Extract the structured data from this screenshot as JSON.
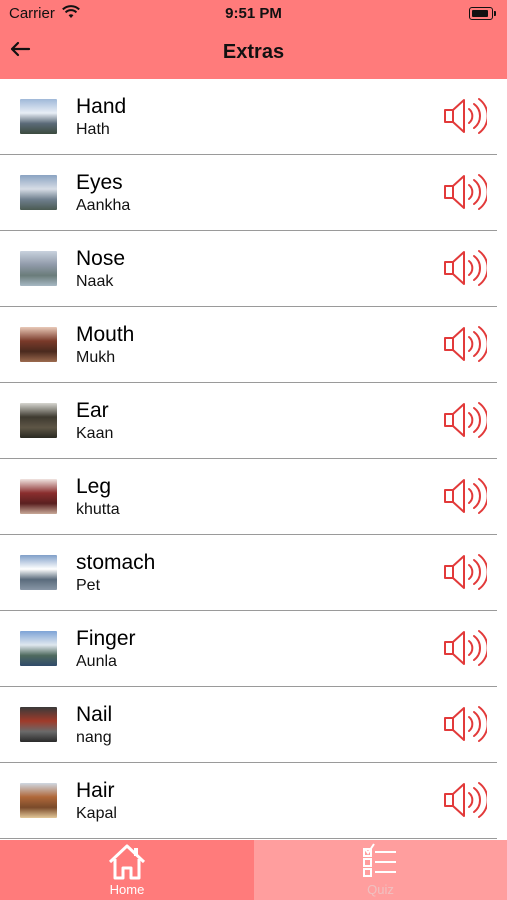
{
  "status": {
    "carrier": "Carrier",
    "time": "9:51 PM",
    "wifi_icon": "wifi-icon",
    "battery_icon": "battery-icon"
  },
  "nav": {
    "title": "Extras",
    "back_icon": "back-arrow-icon"
  },
  "items": [
    {
      "word": "Hand",
      "translation": "Hath",
      "thumb": "mountain-thumbnail",
      "colors": [
        "#9fb8d8",
        "#e8eef6",
        "#5b6a78",
        "#3b4a3e"
      ]
    },
    {
      "word": "Eyes",
      "translation": "Aankha",
      "thumb": "lake-thumbnail",
      "colors": [
        "#8aa3c2",
        "#d7dde6",
        "#6f7f8e",
        "#4a5a52"
      ]
    },
    {
      "word": "Nose",
      "translation": "Naak",
      "thumb": "lake-thumbnail",
      "colors": [
        "#c9d2de",
        "#8f99a8",
        "#6a7c7a",
        "#a7b8c4"
      ]
    },
    {
      "word": "Mouth",
      "translation": "Mukh",
      "thumb": "pagoda-thumbnail",
      "colors": [
        "#e9c9b8",
        "#7a3a2a",
        "#4a2a1e",
        "#9c6a4e"
      ]
    },
    {
      "word": "Ear",
      "translation": "Kaan",
      "thumb": "temple-thumbnail",
      "colors": [
        "#d6d6d0",
        "#3e3a30",
        "#5e5646",
        "#2a2a22"
      ]
    },
    {
      "word": "Leg",
      "translation": "khutta",
      "thumb": "pagoda-thumbnail",
      "colors": [
        "#f0e4e0",
        "#8a2e2e",
        "#5a2020",
        "#c8a898"
      ]
    },
    {
      "word": "stomach",
      "translation": "Pet",
      "thumb": "mountain-thumbnail",
      "colors": [
        "#7f9fc8",
        "#ffffff",
        "#5a6b7c",
        "#8896a6"
      ]
    },
    {
      "word": "Finger",
      "translation": "Aunla",
      "thumb": "lake-thumbnail",
      "colors": [
        "#7ea3d6",
        "#dfe7ee",
        "#4f6a5e",
        "#2f4a6a"
      ]
    },
    {
      "word": "Nail",
      "translation": "nang",
      "thumb": "temple-thumbnail",
      "colors": [
        "#3a3a3a",
        "#a03a2a",
        "#6a6a6a",
        "#2a2a2a"
      ]
    },
    {
      "word": "Hair",
      "translation": "Kapal",
      "thumb": "palace-thumbnail",
      "colors": [
        "#cfd8e2",
        "#b0683a",
        "#7a4a2a",
        "#e3c89a"
      ]
    }
  ],
  "speaker_icon": "speaker-icon",
  "tabs": [
    {
      "label": "Home",
      "icon": "home-icon",
      "selected": true
    },
    {
      "label": "Quiz",
      "icon": "checklist-icon",
      "selected": false
    }
  ],
  "colors": {
    "accent": "#ff7b7b",
    "tab_unselected": "#ff9e9e",
    "speaker": "#e23a3a"
  }
}
